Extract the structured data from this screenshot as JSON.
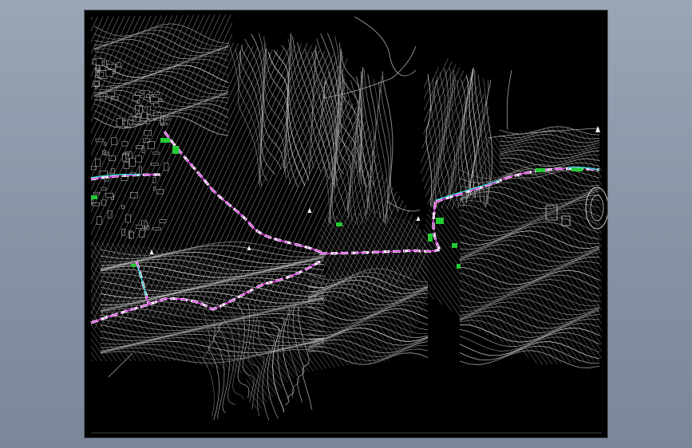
{
  "viewer": {
    "background_top": "#9aa6b6",
    "background_bottom": "#7a8799",
    "canvas_color": "#000000"
  },
  "map": {
    "contour_color": "#8c8c8c",
    "contour_light_color": "#bdbdbd",
    "road_centerline_color": "#e040e8",
    "road_edge_color": "#ffffff",
    "vegetation_color": "#22cc33",
    "water_color": "#33d6c8",
    "north_arrow_icon": "triangle-marker-icon"
  }
}
